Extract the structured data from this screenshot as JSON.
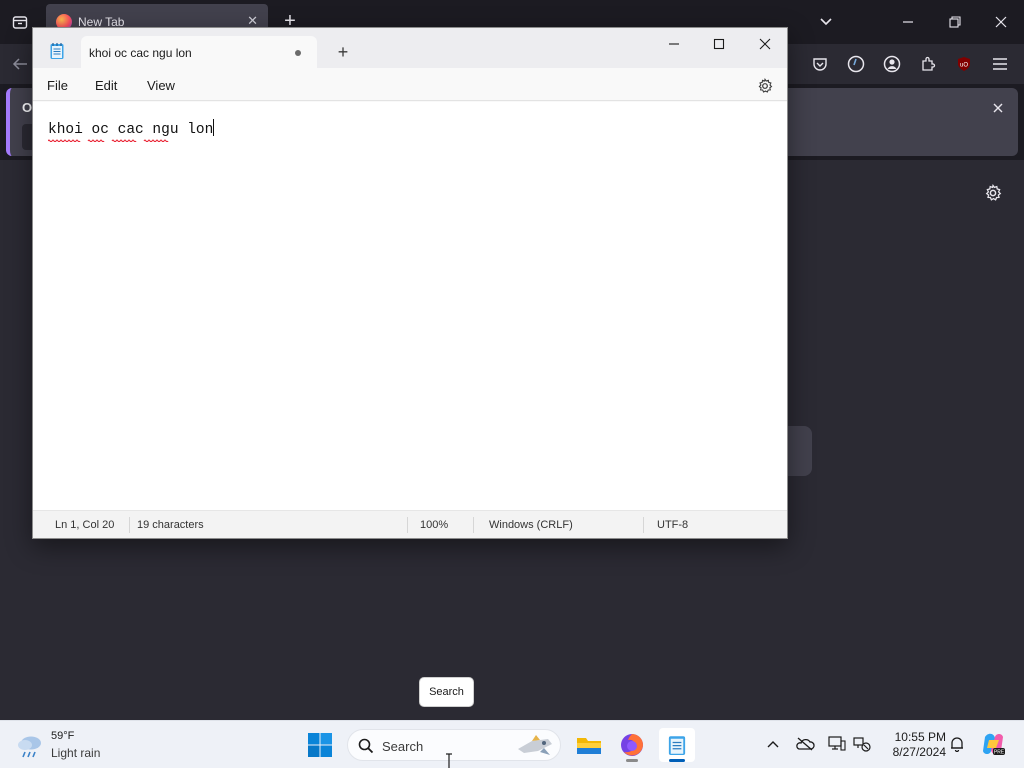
{
  "browser": {
    "tab_title": "New Tab",
    "notice_label": "O"
  },
  "notepad": {
    "tab_title": "khoi oc cac ngu lon",
    "menu": {
      "file": "File",
      "edit": "Edit",
      "view": "View"
    },
    "content": "khoi oc cac ngu lon",
    "status": {
      "position": "Ln 1, Col 20",
      "characters": "19 characters",
      "zoom": "100%",
      "line_ending": "Windows (CRLF)",
      "encoding": "UTF-8"
    }
  },
  "search_tooltip": "Search",
  "taskbar": {
    "weather": {
      "temp": "59°F",
      "condition": "Light rain"
    },
    "search_placeholder": "Search",
    "clock": {
      "time": "10:55 PM",
      "date": "8/27/2024"
    }
  },
  "colors": {
    "accent": "#005fb8",
    "spellcheck": "#e81123",
    "ublock": "#800000"
  }
}
